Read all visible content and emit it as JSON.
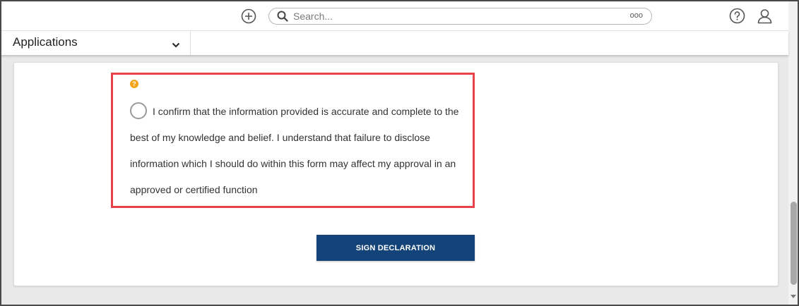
{
  "header": {
    "search": {
      "placeholder": "Search...",
      "more": "ooo"
    }
  },
  "subbar": {
    "app_select": {
      "label": "Applications"
    }
  },
  "declaration": {
    "text": "I confirm that the information provided is accurate and complete to the best of my knowledge and belief. I understand that failure to disclose information which I should do within this form may affect my approval in an approved or certified function",
    "help_glyph": "?",
    "highlight_color": "#e8434b"
  },
  "actions": {
    "sign_label": "SIGN DECLARATION",
    "sign_color": "#144379"
  }
}
